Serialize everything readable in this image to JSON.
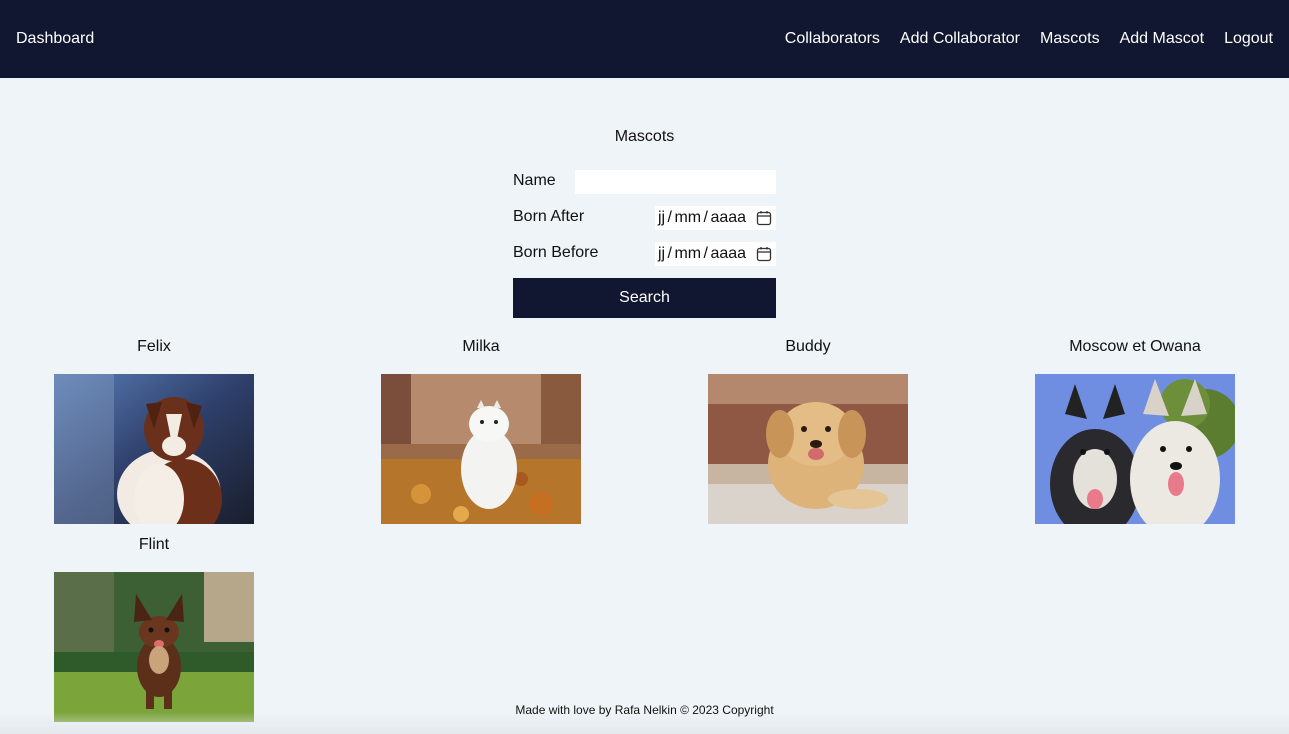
{
  "nav": {
    "brand": "Dashboard",
    "links": [
      "Collaborators",
      "Add Collaborator",
      "Mascots",
      "Add Mascot",
      "Logout"
    ]
  },
  "page": {
    "title": "Mascots"
  },
  "form": {
    "name_label": "Name",
    "name_value": "",
    "born_after_label": "Born After",
    "born_after_placeholder": "jj / mm / aaaa",
    "born_before_label": "Born Before",
    "born_before_placeholder": "jj / mm / aaaa",
    "search_label": "Search"
  },
  "mascots": [
    {
      "name": "Felix",
      "photo": "brown-white-australian-shepherd-puppy"
    },
    {
      "name": "Milka",
      "photo": "white-samoyed-autumn-leaves"
    },
    {
      "name": "Buddy",
      "photo": "golden-retriever-puppy"
    },
    {
      "name": "Moscow et Owana",
      "photo": "two-huskies"
    },
    {
      "name": "Flint",
      "photo": "chihuahua-running-grass"
    }
  ],
  "footer": {
    "text": "Made with love by Rafa Nelkin © 2023 Copyright"
  },
  "colors": {
    "navbar": "#111631",
    "background": "#eff4f9",
    "button": "#111631"
  }
}
